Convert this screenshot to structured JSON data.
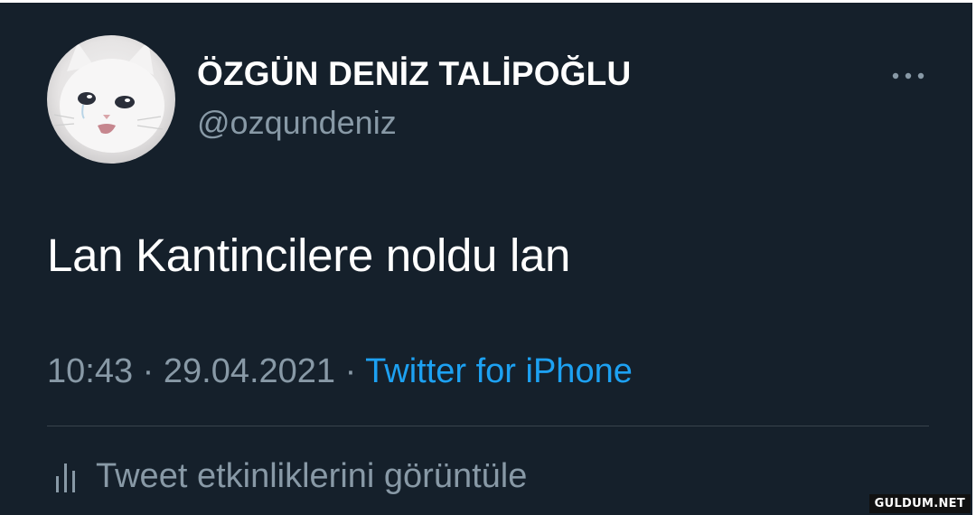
{
  "tweet": {
    "author": {
      "display_name": "ÖZGÜN DENİZ TALİPOĞLU",
      "handle": "@ozqundeniz",
      "avatar": "crying-white-cat-avatar"
    },
    "text": "Lan Kantincilere noldu lan",
    "time": "10:43",
    "separator": "·",
    "date": "29.04.2021",
    "source": "Twitter for iPhone",
    "activity_label": "Tweet etkinliklerini görüntüle",
    "more_icon": "more-horizontal-icon",
    "activity_icon": "bar-chart-icon"
  },
  "watermark": "GULDUM.NET",
  "colors": {
    "background": "#15202b",
    "text_primary": "#ffffff",
    "text_secondary": "#8899a6",
    "link": "#1da1f2",
    "divider": "#38444d"
  }
}
